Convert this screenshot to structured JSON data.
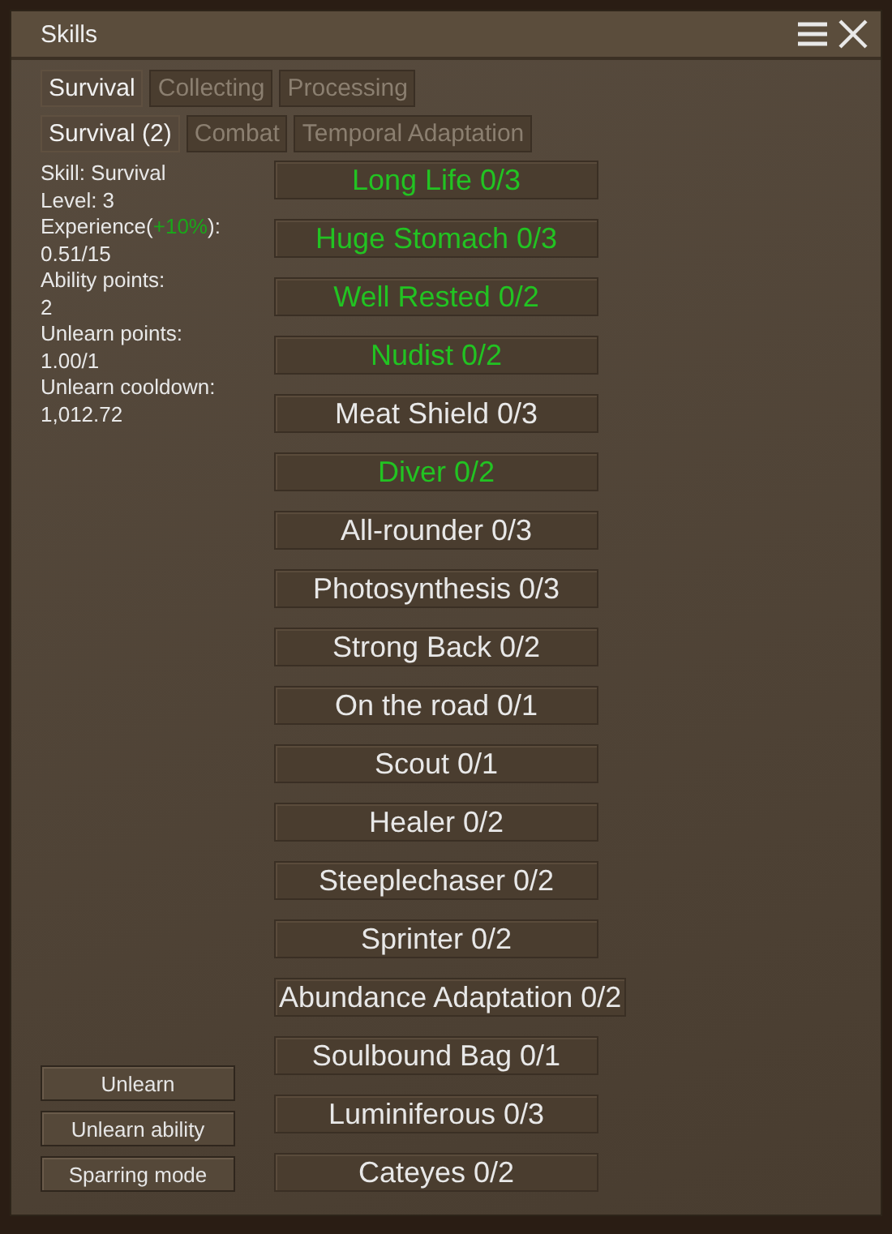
{
  "window": {
    "title": "Skills"
  },
  "tabs": [
    {
      "label": "Survival",
      "selected": true
    },
    {
      "label": "Collecting",
      "selected": false
    },
    {
      "label": "Processing",
      "selected": false
    }
  ],
  "subtabs": [
    {
      "label": "Survival (2)",
      "selected": true
    },
    {
      "label": "Combat",
      "selected": false
    },
    {
      "label": "Temporal Adaptation",
      "selected": false
    }
  ],
  "info": [
    {
      "text": "Skill: Survival"
    },
    {
      "text": "Level: 3"
    },
    {
      "text": "Experience(",
      "bonus": "+10%",
      "suffix": "):"
    },
    {
      "text": "0.51/15"
    },
    {
      "text": "Ability points:"
    },
    {
      "text": "2"
    },
    {
      "text": "Unlearn points:"
    },
    {
      "text": "1.00/1"
    },
    {
      "text": "Unlearn cooldown:"
    },
    {
      "text": "1,012.72"
    }
  ],
  "buttons": [
    "Unlearn",
    "Unlearn ability",
    "Sparring mode"
  ],
  "skills": [
    {
      "label": "Long Life 0/3",
      "available": true
    },
    {
      "label": "Huge Stomach 0/3",
      "available": true
    },
    {
      "label": "Well Rested 0/2",
      "available": true
    },
    {
      "label": "Nudist 0/2",
      "available": true
    },
    {
      "label": "Meat Shield 0/3",
      "available": false
    },
    {
      "label": "Diver 0/2",
      "available": true
    },
    {
      "label": "All-rounder 0/3",
      "available": false
    },
    {
      "label": "Photosynthesis 0/3",
      "available": false
    },
    {
      "label": "Strong Back 0/2",
      "available": false
    },
    {
      "label": "On the road 0/1",
      "available": false
    },
    {
      "label": "Scout 0/1",
      "available": false
    },
    {
      "label": "Healer 0/2",
      "available": false
    },
    {
      "label": "Steeplechaser 0/2",
      "available": false
    },
    {
      "label": "Sprinter 0/2",
      "available": false
    },
    {
      "label": "Abundance Adaptation 0/2",
      "available": false
    },
    {
      "label": "Soulbound Bag 0/1",
      "available": false
    },
    {
      "label": "Luminiferous 0/3",
      "available": false
    },
    {
      "label": "Cateyes 0/2",
      "available": false
    }
  ]
}
